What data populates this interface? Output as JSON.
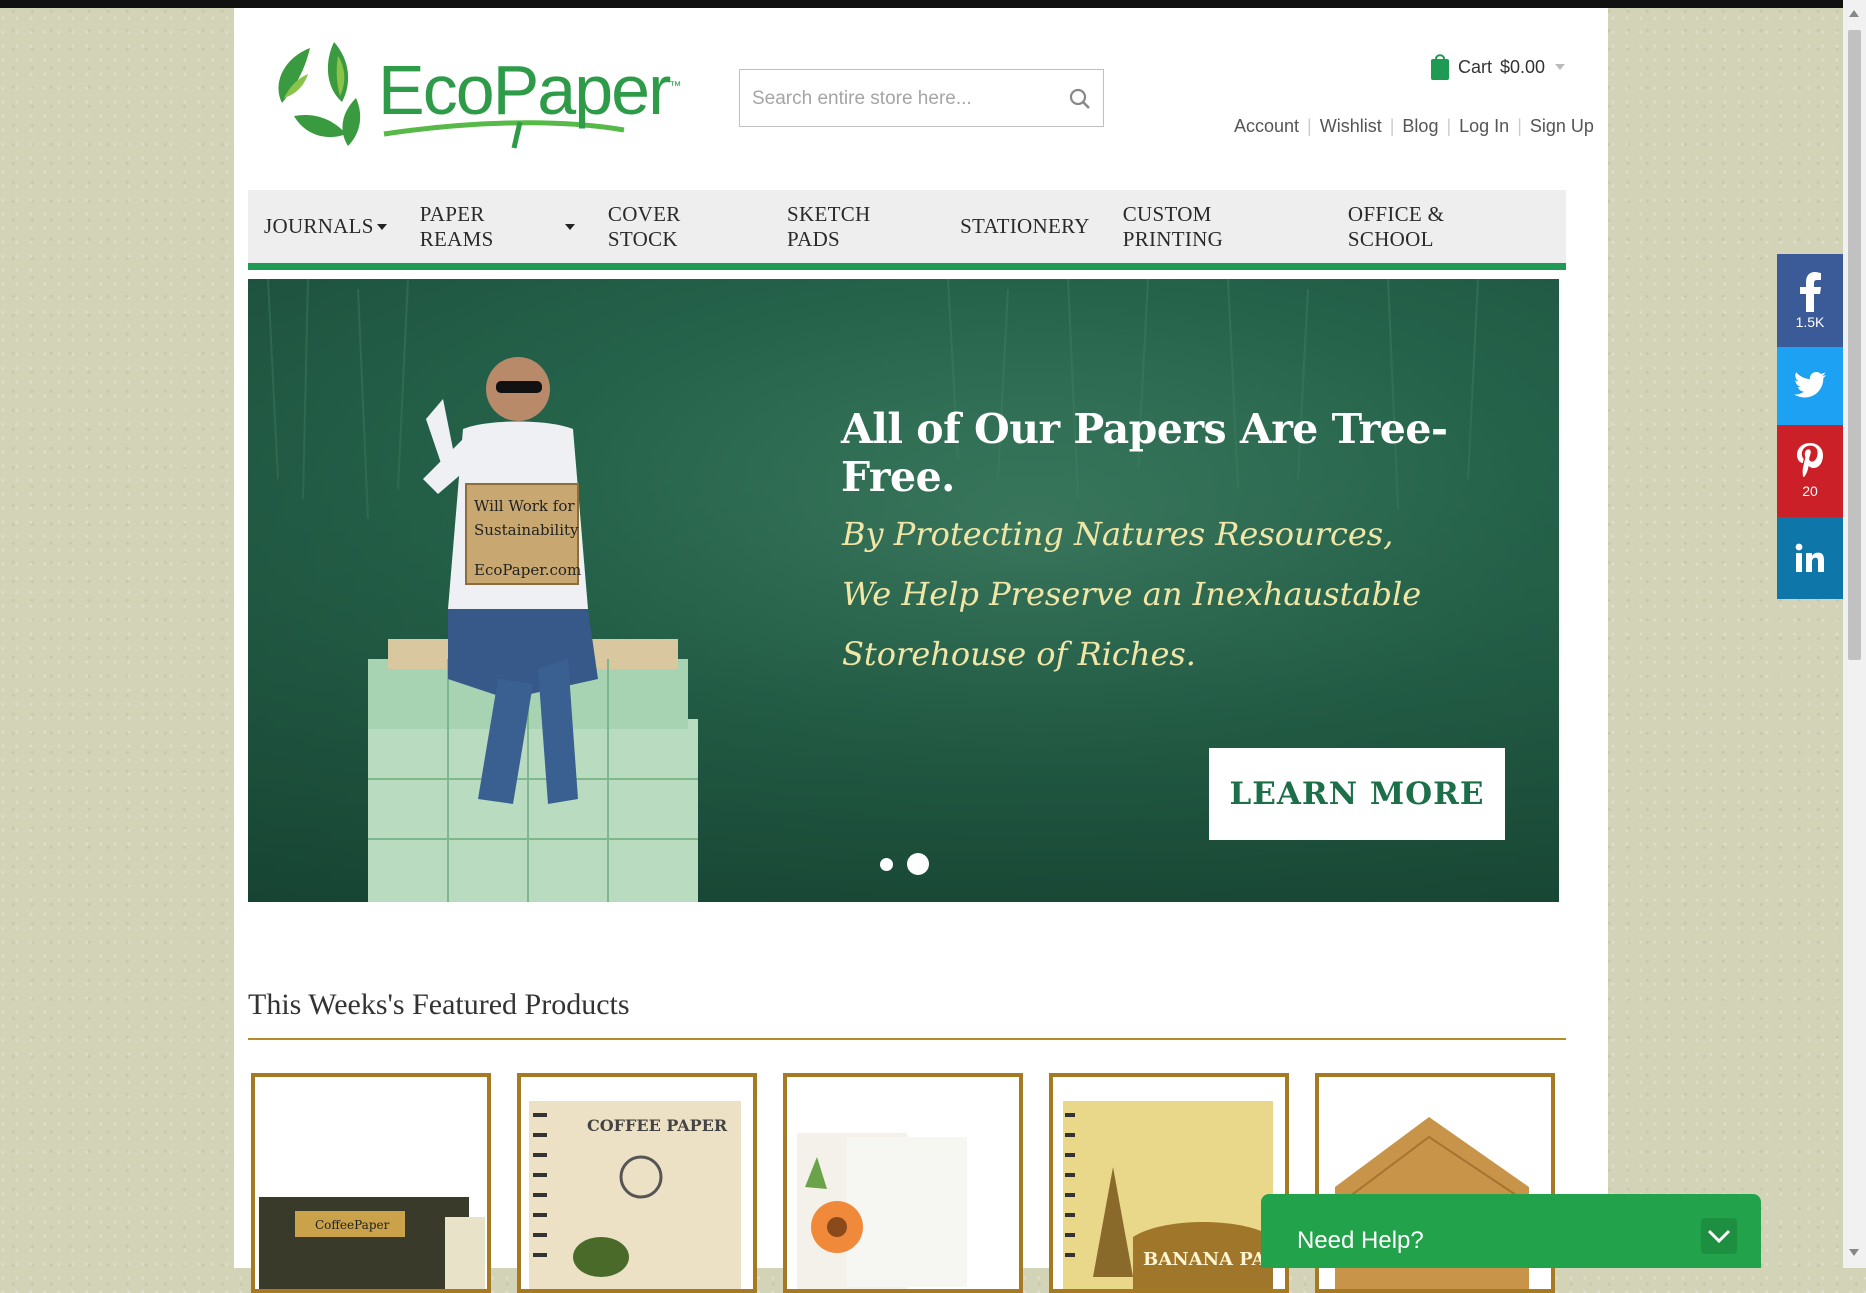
{
  "brand": {
    "name": "EcoPaper",
    "trademark": "™",
    "color": "#2e9b49"
  },
  "search": {
    "placeholder": "Search entire store here...",
    "icon": "search-icon"
  },
  "cart": {
    "label": "Cart",
    "amount": "$0.00",
    "icon": "shopping-bag-icon"
  },
  "account_links": [
    "Account",
    "Wishlist",
    "Blog",
    "Log In",
    "Sign Up"
  ],
  "nav": [
    {
      "label": "JOURNALS",
      "dropdown": true
    },
    {
      "label": "PAPER REAMS",
      "dropdown": true
    },
    {
      "label": "COVER STOCK",
      "dropdown": false
    },
    {
      "label": "SKETCH PADS",
      "dropdown": false
    },
    {
      "label": "STATIONERY",
      "dropdown": false
    },
    {
      "label": "CUSTOM PRINTING",
      "dropdown": false
    },
    {
      "label": "OFFICE & SCHOOL",
      "dropdown": false
    }
  ],
  "hero": {
    "title": "All of Our Papers Are Tree-Free.",
    "subtitle_lines": [
      "By Protecting Natures Resources,",
      "We Help Preserve an Inexhaustable",
      "Storehouse of Riches."
    ],
    "cta": "LEARN MORE",
    "sign_text": [
      "Will Work for",
      "Sustainability",
      "EcoPaper.com"
    ],
    "slides": 2,
    "active_slide": 2
  },
  "featured": {
    "title": "This Weeks's Featured Products",
    "products": [
      {
        "label": "CoffeePaper"
      },
      {
        "label": "COFFEE PAPER"
      },
      {
        "label": ""
      },
      {
        "label": "BANANA PAPER"
      },
      {
        "label": ""
      }
    ]
  },
  "social": {
    "facebook": {
      "icon": "facebook-icon",
      "count": "1.5K",
      "color": "#3b5a98"
    },
    "twitter": {
      "icon": "twitter-icon",
      "color": "#1da1f2"
    },
    "pinterest": {
      "icon": "pinterest-icon",
      "count": "20",
      "color": "#cb2027"
    },
    "linkedin": {
      "icon": "linkedin-icon",
      "color": "#0e76a8"
    }
  },
  "help": {
    "label": "Need Help?",
    "icon": "chevron-down-icon"
  }
}
